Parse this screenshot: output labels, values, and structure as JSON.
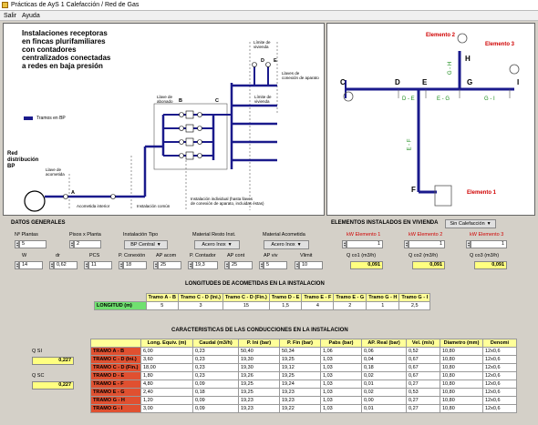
{
  "window": {
    "title": "Prácticas de AyS 1 Calefacción /  Red de Gas"
  },
  "menu": {
    "file": "Salir",
    "help": "Ayuda"
  },
  "left_diagram": {
    "heading_lines": [
      "Instalaciones receptoras",
      "en fincas plurifamiliares",
      "con contadores",
      "centralizados conectadas",
      "a redes en baja presión"
    ],
    "legend": "Tramos en BP",
    "red_label": [
      "Red",
      "distribución",
      "BP"
    ],
    "llave_acometida": [
      "Llave de",
      "acometida"
    ],
    "llave_abonado": [
      "Llave de",
      "abonado"
    ],
    "limite_vivienda_1": [
      "Límite de",
      "vivienda"
    ],
    "limite_vivienda_2": [
      "Límite de",
      "vivienda"
    ],
    "llaves_conexion": [
      "Llaves de",
      "conexión de aparato"
    ],
    "acometida_interior": "Acometida interior",
    "instalacion_comun": "Instalación común",
    "instalacion_individual": [
      "Instalación individual (hasta llaves",
      "de conexión de aparato, incluidas éstas)"
    ],
    "points": {
      "a": "A",
      "b": "B",
      "c": "C",
      "d": "D",
      "e": "E"
    }
  },
  "right_diagram": {
    "elemento1": "Elemento 1",
    "elemento2": "Elemento 2",
    "elemento3": "Elemento 3",
    "points": {
      "c": "C",
      "d": "D",
      "e": "E",
      "f": "F",
      "g": "G",
      "h": "H",
      "i": "I"
    },
    "segments": {
      "de": "D - E",
      "eg": "E - G",
      "gi": "G - I",
      "gh": "G - H",
      "ef": "E - F"
    }
  },
  "datos": {
    "title": "DATOS GENERALES",
    "n_plantas_label": "Nº Plantas",
    "n_plantas": "5",
    "pisos_label": "Pisos x Planta",
    "pisos": "2",
    "tipo_label": "Instalación Tipo",
    "tipo": "BP Central",
    "mat_resto_label": "Material Resto Inst.",
    "mat_resto": "Acero Inox",
    "mat_acom_label": "Material Acometida",
    "mat_acom": "Acero Inox",
    "w_label": "W",
    "w": "14",
    "dr_label": "dr",
    "dr": "0,62",
    "pcs_label": "PCS",
    "pcs": "11",
    "pcon_label": "P. Conexión",
    "pcon": "18",
    "apacom_label": "AP acom",
    "apacom": "25",
    "pcont_label": "P. Contador",
    "pcont": "19,3",
    "apcont_label": "AP cont",
    "apcont": "25",
    "apviv_label": "AP viv",
    "apviv": "5",
    "vmit_label": "Vlimit",
    "vmit": "10"
  },
  "elementos": {
    "title": "ELEMENTOS INSTALADOS EN VIVIENDA",
    "selector": "Sin Calefacción",
    "kw1_label": "kW Elemento 1",
    "kw1": "1",
    "kw2_label": "kW Elemento 2",
    "kw2": "1",
    "kw3_label": "kW Elemento 3",
    "kw3": "1",
    "q1_label": "Q co1 (m3/h)",
    "q1": "0,091",
    "q2_label": "Q co2 (m3/h)",
    "q2": "0,091",
    "q3_label": "Q co3 (m3/h)",
    "q3": "0,091"
  },
  "longitudes": {
    "title": "LONGITUDES DE ACOMETIDAS EN LA INSTALACION",
    "row_label": "LONGITUD (m)",
    "headers": [
      "Tramo A - B",
      "Tramo C - D (Ini.)",
      "Tramo C - D (Fin.)",
      "Tramo D - E",
      "Tramo E - F",
      "Tramo E - G",
      "Tramo G - H",
      "Tramo G - I"
    ],
    "values": [
      "5",
      "3",
      "15",
      "1,5",
      "4",
      "2",
      "1",
      "2,5"
    ]
  },
  "conducciones": {
    "title": "CARACTERISTICAS DE LAS CONDUCCIONES EN LA INSTALACION",
    "qsi_label": "Q SI",
    "qsi": "0,227",
    "qsc_label": "Q SC",
    "qsc": "0,227",
    "headers": [
      "",
      "Long. Equiv. (m)",
      "Caudal (m3/h)",
      "P. Ini (bar)",
      "P. Fin (bar)",
      "Pabs (bar)",
      "AP. Real (bar)",
      "Vel. (m/s)",
      "Diametro (mm)",
      "Denomi"
    ],
    "rows": [
      [
        "TRAMO A - B",
        "6,00",
        "0,23",
        "50,40",
        "50,34",
        "1,06",
        "0,06",
        "0,52",
        "10,80",
        "12x0,6"
      ],
      [
        "TRAMO C - D (Ini.)",
        "3,60",
        "0,23",
        "19,30",
        "19,25",
        "1,03",
        "0,04",
        "0,67",
        "10,80",
        "12x0,6"
      ],
      [
        "TRAMO C - D (Fin.)",
        "18,00",
        "0,23",
        "19,30",
        "19,12",
        "1,03",
        "0,18",
        "0,67",
        "10,80",
        "12x0,6"
      ],
      [
        "TRAMO D - E",
        "1,80",
        "0,23",
        "19,26",
        "19,25",
        "1,03",
        "0,02",
        "0,67",
        "10,80",
        "12x0,6"
      ],
      [
        "TRAMO E - F",
        "4,80",
        "0,09",
        "19,25",
        "19,24",
        "1,03",
        "0,01",
        "0,27",
        "10,80",
        "12x0,6"
      ],
      [
        "TRAMO E - G",
        "2,40",
        "0,18",
        "19,25",
        "19,23",
        "1,03",
        "0,02",
        "0,53",
        "10,80",
        "12x0,6"
      ],
      [
        "TRAMO G - H",
        "1,20",
        "0,09",
        "19,23",
        "19,23",
        "1,03",
        "0,00",
        "0,27",
        "10,80",
        "12x0,6"
      ],
      [
        "TRAMO G - I",
        "3,00",
        "0,09",
        "19,23",
        "19,22",
        "1,03",
        "0,01",
        "0,27",
        "10,80",
        "12x0,6"
      ]
    ]
  },
  "colors": {
    "pipe": "#1a1a8c",
    "accent_red": "#d00000",
    "tramo_bg": "#e05030",
    "header_bg": "#ffff99",
    "green": "#70e070"
  }
}
